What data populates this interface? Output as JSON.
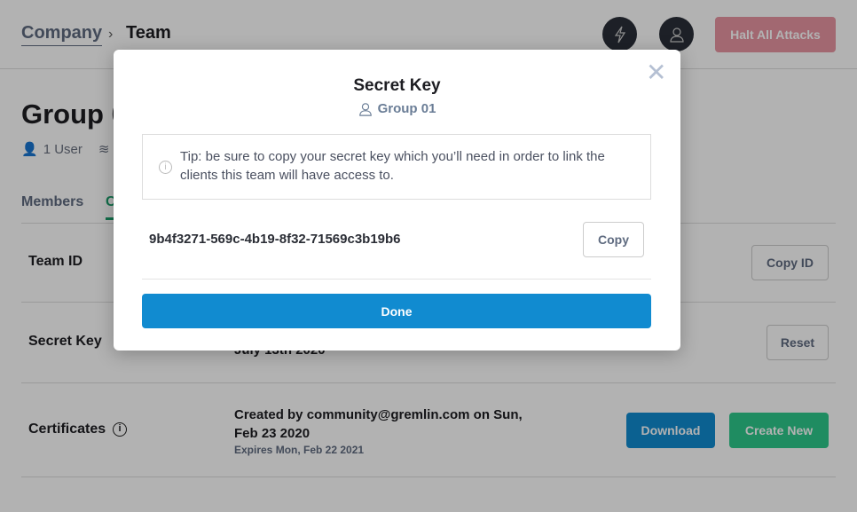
{
  "breadcrumb": {
    "parent": "Company",
    "current": "Team"
  },
  "header": {
    "halt_label": "Halt All Attacks",
    "icons": [
      "lightning-icon",
      "user-icon"
    ]
  },
  "group": {
    "title": "Group 01",
    "users": "1 User"
  },
  "tabs": [
    {
      "label": "Members"
    },
    {
      "label": "C"
    }
  ],
  "rows": {
    "team_id": {
      "label": "Team ID",
      "button": "Copy ID"
    },
    "secret_key": {
      "label": "Secret Key",
      "detail": "July 13th 2020",
      "button": "Reset"
    },
    "certificates": {
      "label": "Certificates",
      "line1": "Created by community@gremlin.com on Sun,",
      "line2": "Feb 23 2020",
      "expires": "Expires Mon, Feb 22 2021",
      "download": "Download",
      "create": "Create New"
    }
  },
  "modal": {
    "title": "Secret Key",
    "subtitle": "Group 01",
    "tip": "Tip: be sure to copy your secret key which you’ll need in order to link the clients this team will have access to.",
    "key": "9b4f3271-569c-4b19-8f32-71569c3b19b6",
    "copy": "Copy",
    "done": "Done"
  },
  "colors": {
    "primary": "#118bd0",
    "success": "#26c384",
    "danger": "#e896a3"
  }
}
